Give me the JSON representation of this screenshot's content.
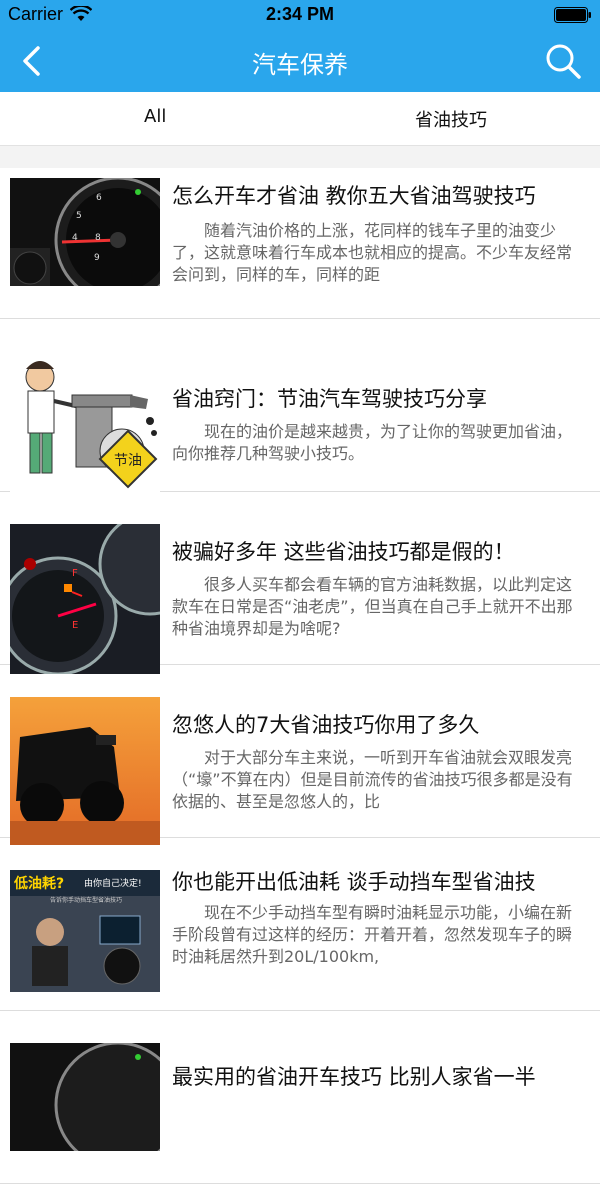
{
  "status": {
    "carrier": "Carrier",
    "time": "2:34 PM"
  },
  "nav": {
    "title": "汽车保养"
  },
  "tabs": [
    {
      "label": "All"
    },
    {
      "label": "省油技巧"
    }
  ],
  "articles": [
    {
      "title": "怎么开车才省油 教你五大省油驾驶技巧",
      "summary": "随着汽油价格的上涨，花同样的钱车子里的油变少了，这就意味着行车成本也就相应的提高。不少车友经常会问到，同样的车，同样的距"
    },
    {
      "title": "省油窍门：节油汽车驾驶技巧分享",
      "summary": "现在的油价是越来越贵，为了让你的驾驶更加省油，向你推荐几种驾驶小技巧。",
      "badge": "节油"
    },
    {
      "title": "被骗好多年 这些省油技巧都是假的！",
      "summary": "很多人买车都会看车辆的官方油耗数据，以此判定这款车在日常是否“油老虎”，但当真在自己手上就开不出那种省油境界却是为啥呢?"
    },
    {
      "title": "忽悠人的7大省油技巧你用了多久",
      "summary": "对于大部分车主来说，一听到开车省油就会双眼发亮（“壕”不算在内）但是目前流传的省油技巧很多都是没有依据的、甚至是忽悠人的，比"
    },
    {
      "title": "你也能开出低油耗 谈手动挡车型省油技",
      "summary": "现在不少手动挡车型有瞬时油耗显示功能，小编在新手阶段曾有过这样的经历：开着开着，忽然发现车子的瞬时油耗居然升到20L/100km,",
      "banner": "低油耗?",
      "banner2": "由你自己决定!",
      "caption": "告诉你手动挡车型省油技巧"
    },
    {
      "title": "最实用的省油开车技巧 比别人家省一半",
      "summary": ""
    }
  ],
  "colors": {
    "nav_bg": "#2aa6ec",
    "nav_text": "#ffffff"
  }
}
